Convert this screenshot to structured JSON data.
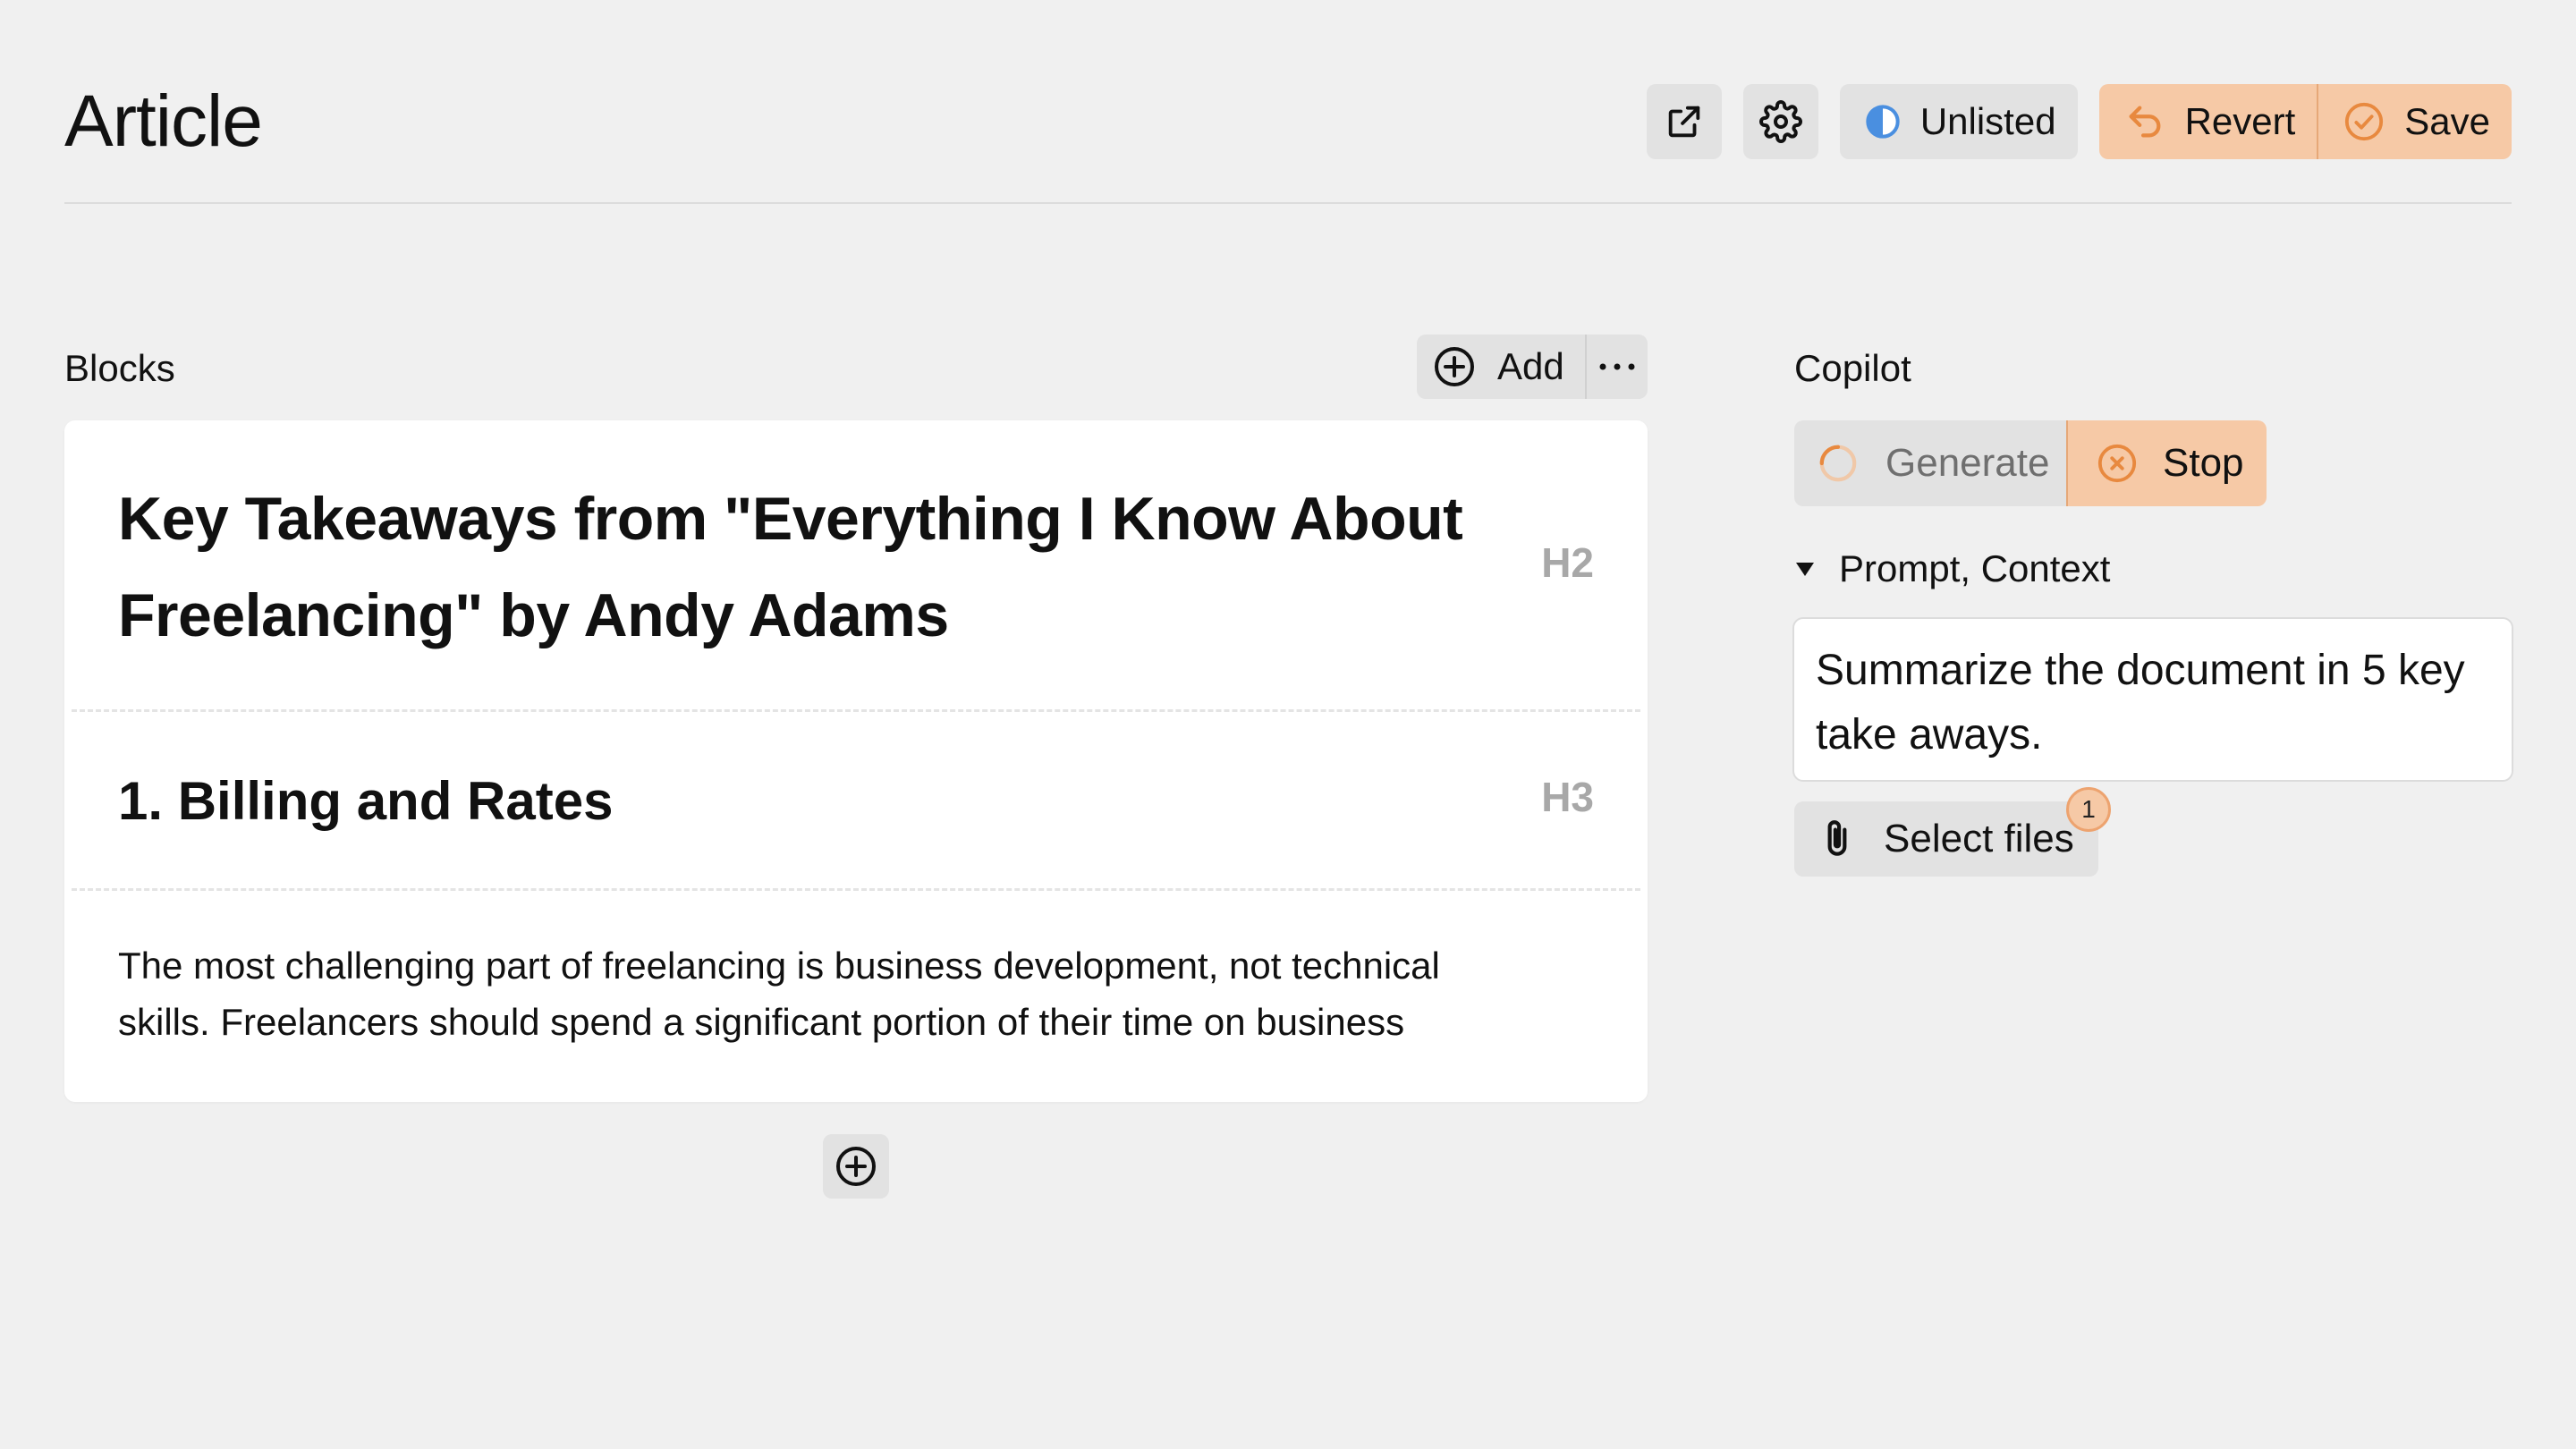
{
  "header": {
    "title": "Article",
    "visibility_label": "Unlisted",
    "revert_label": "Revert",
    "save_label": "Save"
  },
  "blocks": {
    "label": "Blocks",
    "add_label": "Add",
    "items": [
      {
        "type": "H2",
        "text": "Key Takeaways from \"Everything I Know About Freelancing\" by Andy Adams"
      },
      {
        "type": "H3",
        "text": "1. Billing and Rates"
      },
      {
        "type": "P",
        "text": "The most challenging part of freelancing is business development, not technical skills. Freelancers should spend a significant portion of their time on business"
      }
    ]
  },
  "copilot": {
    "label": "Copilot",
    "generate_label": "Generate",
    "stop_label": "Stop",
    "prompt_toggle_label": "Prompt, Context",
    "prompt_text": "Summarize the document in 5 key take aways.",
    "select_files_label": "Select files",
    "files_count": "1"
  },
  "colors": {
    "accent_orange": "#f6c9a6",
    "accent_orange_stroke": "#e8893f",
    "visibility_blue": "#4a8fe0",
    "background": "#f0f0f0",
    "button_gray": "#e2e2e2"
  },
  "icons": {
    "open_external": "external-link-icon",
    "settings": "gear-icon",
    "visibility": "half-circle-icon",
    "revert": "undo-arrow-icon",
    "save": "check-circle-icon",
    "add": "plus-circle-icon",
    "more": "ellipsis-icon",
    "generate": "spinner-icon",
    "stop": "x-circle-icon",
    "toggle": "triangle-down-icon",
    "attach": "paperclip-icon"
  }
}
